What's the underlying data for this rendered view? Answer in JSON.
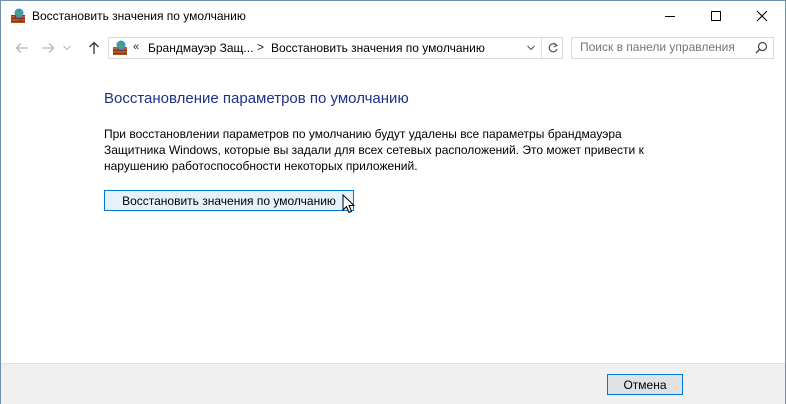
{
  "window": {
    "title": "Восстановить значения по умолчанию",
    "icon": "firewall-icon",
    "controls": [
      "minimize-icon",
      "maximize-icon",
      "close-icon"
    ]
  },
  "nav": {
    "back_icon": "arrow-left-icon",
    "forward_icon": "arrow-right-icon",
    "recent_icon": "chevron-down-icon",
    "up_icon": "arrow-up-icon"
  },
  "address": {
    "overflow": "«",
    "crumbs": [
      "Брандмауэр Защ...",
      "Восстановить значения по умолчанию"
    ],
    "separator": ">",
    "refresh_icon": "refresh-icon"
  },
  "search": {
    "placeholder": "Поиск в панели управления",
    "icon": "search-icon"
  },
  "content": {
    "heading": "Восстановление параметров по умолчанию",
    "description": "При восстановлении параметров по умолчанию будут удалены все параметры брандмауэра Защитника Windows, которые вы задали для всех сетевых расположений. Это может привести к нарушению работоспособности некоторых приложений.",
    "restore_button": "Восстановить значения по умолчанию"
  },
  "footer": {
    "cancel_button": "Отмена"
  },
  "colors": {
    "heading": "#1e3287",
    "accent": "#0078d7",
    "footer_bg": "#f0f0f0"
  }
}
